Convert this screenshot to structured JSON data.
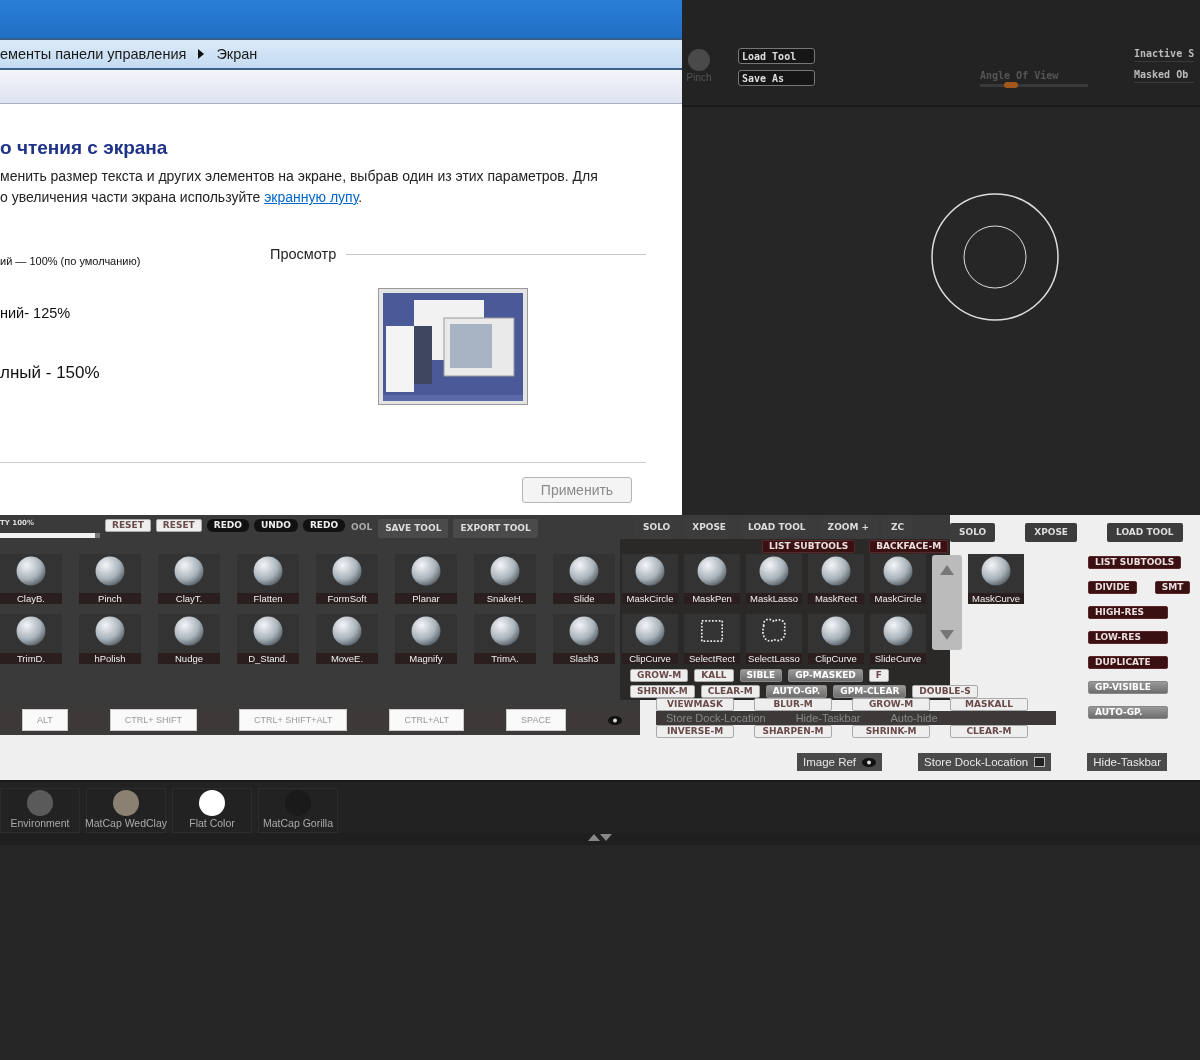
{
  "control_panel": {
    "breadcrumb": [
      "ементы панели управления",
      "Экран"
    ],
    "heading": "о чтения с экрана",
    "description": [
      "менить размер текста и других элементов на экране, выбрав один из этих параметров. Для",
      "о увеличения части экрана используйте "
    ],
    "link": "экранную лупу",
    "description_end": ".",
    "options": [
      {
        "label": "ий — 100% (по умолчанию)",
        "kind": "small"
      },
      {
        "label": "ний- 125%",
        "kind": "medium"
      },
      {
        "label": "лный - 150%",
        "kind": "large"
      }
    ],
    "preview_title": "Просмотр",
    "apply_button": {
      "label": "Применить",
      "disabled": true
    }
  },
  "zbrush_header": {
    "brush": "Pinch",
    "buttons": [
      "Load Tool",
      "Save As"
    ],
    "slider": {
      "label": "Angle Of View",
      "level": 0.25
    },
    "options": [
      "Inactive S",
      "Masked Ob"
    ]
  },
  "toolbar": {
    "opacity": {
      "label": "TY 100%",
      "level": 0.95
    },
    "buttons": [
      {
        "label": "RESET",
        "kind": "light"
      },
      {
        "label": "RESET",
        "kind": "light"
      },
      {
        "label": "REDO",
        "kind": "dark"
      },
      {
        "label": "UNDO",
        "kind": "dark"
      },
      {
        "label": "REDO",
        "kind": "dark"
      },
      {
        "label": "OOL",
        "kind": "plain"
      },
      {
        "label": "SAVE TOOL",
        "kind": "tab"
      },
      {
        "label": "EXPORT TOOL",
        "kind": "tab"
      }
    ]
  },
  "subtool_tabs": [
    "SOLO",
    "XPOSE",
    "LOAD TOOL",
    "ZOOM +",
    "ZC"
  ],
  "subtool_buttons_top": [
    {
      "label": "LIST SUBTOOLS",
      "kind": "red"
    },
    {
      "label": "BACKFACE-M",
      "kind": "red"
    }
  ],
  "subtool_buttons_bottom": [
    [
      {
        "label": "GROW-M",
        "kind": "light"
      },
      {
        "label": "KALL",
        "kind": "light"
      },
      {
        "label": "SIBLE",
        "kind": "grey"
      },
      {
        "label": "GP-MASKED",
        "kind": "grey"
      },
      {
        "label": "F",
        "kind": "light"
      }
    ],
    [
      {
        "label": "SHRINK-M",
        "kind": "light"
      },
      {
        "label": "CLEAR-M",
        "kind": "light"
      },
      {
        "label": "AUTO-GP.",
        "kind": "grey"
      },
      {
        "label": "GPM-CLEAR",
        "kind": "grey"
      },
      {
        "label": "DOUBLE-S",
        "kind": "light"
      }
    ]
  ],
  "brushes": [
    [
      {
        "label": "ClayB.",
        "kind": "sphere"
      },
      {
        "label": "Pinch",
        "kind": "sphere"
      },
      {
        "label": "ClayT.",
        "kind": "sphere"
      },
      {
        "label": "Flatten",
        "kind": "sphere"
      },
      {
        "label": "FormSoft",
        "kind": "sphere"
      },
      {
        "label": "Planar",
        "kind": "sphere"
      },
      {
        "label": "SnakeH.",
        "kind": "sphere"
      },
      {
        "label": "Slide",
        "kind": "sphere"
      },
      {
        "label": "MaskCircle",
        "kind": "sphere"
      },
      {
        "label": "MaskPen",
        "kind": "sphere"
      },
      {
        "label": "MaskLasso",
        "kind": "sphere"
      },
      {
        "label": "MaskRect",
        "kind": "sphere"
      },
      {
        "label": "MaskCircle",
        "kind": "sphere"
      },
      {
        "label": "MaskCurve",
        "kind": "sphere"
      }
    ],
    [
      {
        "label": "TrimD.",
        "kind": "sphere"
      },
      {
        "label": "hPolish",
        "kind": "sphere"
      },
      {
        "label": "Nudge",
        "kind": "sphere"
      },
      {
        "label": "D_Stand.",
        "kind": "sphere"
      },
      {
        "label": "MoveE.",
        "kind": "sphere"
      },
      {
        "label": "Magnify",
        "kind": "sphere"
      },
      {
        "label": "TrimA.",
        "kind": "sphere"
      },
      {
        "label": "Slash3",
        "kind": "sphere"
      },
      {
        "label": "ClipCurve",
        "kind": "sphere"
      },
      {
        "label": "SelectRect",
        "kind": "select-rect"
      },
      {
        "label": "SelectLasso",
        "kind": "select-lasso"
      },
      {
        "label": "ClipCurve",
        "kind": "sphere"
      },
      {
        "label": "SlideCurve",
        "kind": "sphere"
      }
    ]
  ],
  "right_tabs": [
    "SOLO",
    "XPOSE",
    "LOAD TOOL"
  ],
  "right_buttons": [
    [
      {
        "label": "LIST SUBTOOLS",
        "kind": "red"
      }
    ],
    [
      {
        "label": "DIVIDE",
        "kind": "red"
      },
      {
        "label": "SMT",
        "kind": "red"
      }
    ],
    [
      {
        "label": "HIGH-RES",
        "kind": "red"
      }
    ],
    [
      {
        "label": "LOW-RES",
        "kind": "red"
      }
    ],
    [
      {
        "label": "DUPLICATE",
        "kind": "red"
      }
    ],
    [
      {
        "label": "GP-VISIBLE",
        "kind": "grey"
      }
    ],
    [
      {
        "label": "AUTO-GP.",
        "kind": "grey"
      }
    ]
  ],
  "modifier_keys": [
    "ALT",
    "CTRL+ SHIFT",
    "CTRL+ SHIFT+ALT",
    "CTRL+ALT",
    "SPACE"
  ],
  "mask_buttons": [
    [
      "VIEWMASK",
      "BLUR-M",
      "GROW-M",
      "MASKALL"
    ],
    [
      "INVERSE-M",
      "SHARPEN-M",
      "SHRINK-M",
      "CLEAR-M"
    ]
  ],
  "dock_strip": [
    "Store Dock-Location",
    "Hide-Taskbar",
    "Auto-hide"
  ],
  "bottom_buttons": [
    {
      "label": "Image Ref",
      "kind": "eye"
    },
    {
      "label": "Store Dock-Location",
      "kind": "square"
    },
    {
      "label": "Hide-Taskbar",
      "kind": "plain"
    }
  ],
  "materials": [
    {
      "label": "Environment",
      "color": "#5a5a5a"
    },
    {
      "label": "MatCap  WedClay",
      "color": "#8a8172"
    },
    {
      "label": "Flat  Color",
      "color": "#ffffff"
    },
    {
      "label": "MatCap  Gorilla",
      "color": "#1a1a1a"
    }
  ]
}
